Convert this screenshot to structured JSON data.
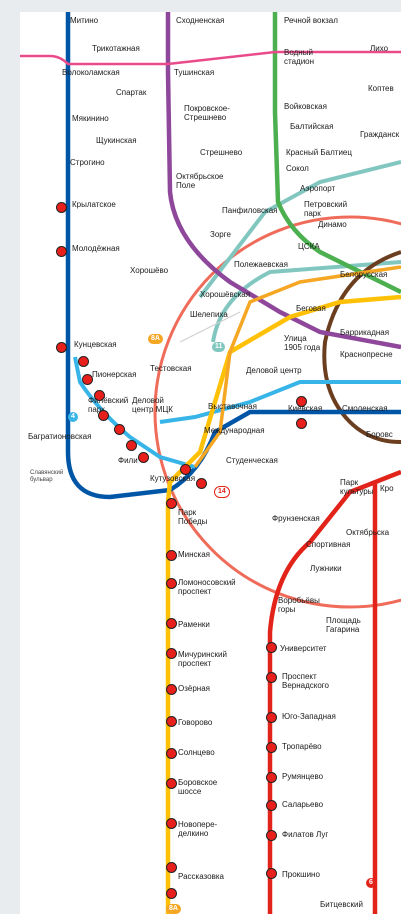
{
  "stations": {
    "mitino": "Митино",
    "skhodnenskaya": "Сходненская",
    "rechnoy_vokzal": "Речной вокзал",
    "trikotazhnaya": "Трикотажная",
    "volokolamskaya": "Волоколамская",
    "tushinskaya": "Тушинская",
    "vodny_stadion": "Водный\nстадион",
    "likhobory": "Лихо",
    "spartak": "Спартак",
    "koptevo": "Коптев",
    "pokrovskoe_streshnevo": "Покровское-\nСтрешнево",
    "myakinino": "Мякинино",
    "voykovskaya": "Войковская",
    "baltiyskaya": "Балтийская",
    "grazhdanskaya": "Гражданск",
    "shchukinskaya": "Щукинская",
    "streshnevo": "Стрешнево",
    "krasny_baltiets": "Красный Балтиец",
    "strogino": "Строгино",
    "sokol": "Сокол",
    "oktyabrskoe_pole": "Октябрьское\nПоле",
    "aeroport": "Аэропорт",
    "krylatskoe": "Крылатское",
    "panfilovskaya": "Панфиловская",
    "petrovsky_park": "Петровский\nпарк",
    "dinamo": "Динамо",
    "zorge": "Зорге",
    "molodezhnaya": "Молодёжная",
    "tsska": "ЦСКА",
    "polezhaevskaya": "Полежаевская",
    "khoroshevo": "Хорошёво",
    "belorusskaya": "Белорусская",
    "khoroshevskaya": "Хорошёвская",
    "begovaya": "Беговая",
    "shelepikha": "Шелепиха",
    "barrikadnaya": "Баррикадная",
    "ulitsa_1905": "Улица\n1905 года",
    "krasnopresnenskaya": "Краснопресне",
    "kuntsevskaya": "Кунцевская",
    "testovskaya": "Тестовская",
    "delovoy_tsentr": "Деловой центр",
    "pionerskaya": "Пионерская",
    "smolenskaya_1": "Смоленская",
    "smolenskaya_2": "Смоленская",
    "filevsky_park": "Филёвский\nпарк",
    "vystavochnaya": "Выставочная",
    "kievskaya": "Киевская",
    "delovoy_tsentr_mck": "Деловой\nцентр МЦК",
    "borovitskaya": "Боровс",
    "bagrationovskaya": "Багратионовская",
    "mezhdunarodnaya": "Международная",
    "studencheskaya": "Студенческая",
    "fili": "Фили",
    "kutuzovskaya": "Кутузовская",
    "slavyansky_bulvar": "Славянский\nбульвар",
    "park_kultury": "Парк\nкультуры",
    "kropotkinskaya": "Кро",
    "park_pobedy": "Парк\nПобеды",
    "frunzenskaya": "Фрунзенская",
    "oktyabrskaya": "Октябрьска",
    "sportivnaya": "Спортивная",
    "minskaya": "Минская",
    "luzhniki": "Лужники",
    "lomonosovsky": "Ломоносовский\nпроспект",
    "vorobyovy_gory": "Воробьёвы\nгоры",
    "ploshchad_gagarina": "Площадь\nГагарина",
    "ramenki": "Раменки",
    "universitet": "Университет",
    "michurinsky": "Мичуринский\nпроспект",
    "prospekt_vernadskogo": "Проспект\nВернадского",
    "ozyornaya": "Озёрная",
    "govorovo": "Говорово",
    "yugo_zapadnaya": "Юго-Западная",
    "troparyovo": "Тропарёво",
    "solntsevo": "Солнцево",
    "rumyantsevo": "Румянцево",
    "borovskoe_shosse": "Боровское\nшоссе",
    "salaryevo": "Саларьево",
    "novoperedelkino": "Новопере-\nделкино",
    "filatov_lug": "Филатов Луг",
    "rasskazovka": "Рассказовка",
    "prokshino": "Прокшино",
    "bitsevsky": "Битцевский"
  },
  "route_badges": {
    "b8a": "8А",
    "b11": "11",
    "b4": "4",
    "b14": "14",
    "b6": "6",
    "b8a_bottom": "8А"
  },
  "line_colors": {
    "arbatsko_pokrovskaya": "#0072ba",
    "tagansko_krasnopresnenskaya": "#8e479b",
    "zamoskvoretskaya": "#4caf50",
    "sokolnicheskaya": "#e2231a",
    "kalininsko_solntsevskaya": "#ffc107",
    "filyovskaya": "#38b5e8",
    "koltsevaya": "#8d5b2d",
    "bolshaya_koltsevaya": "#81c7c0",
    "mck": "#f06c5a",
    "mcd": "#e94b8a",
    "marker": "#e8201c"
  },
  "markers_note": ""
}
